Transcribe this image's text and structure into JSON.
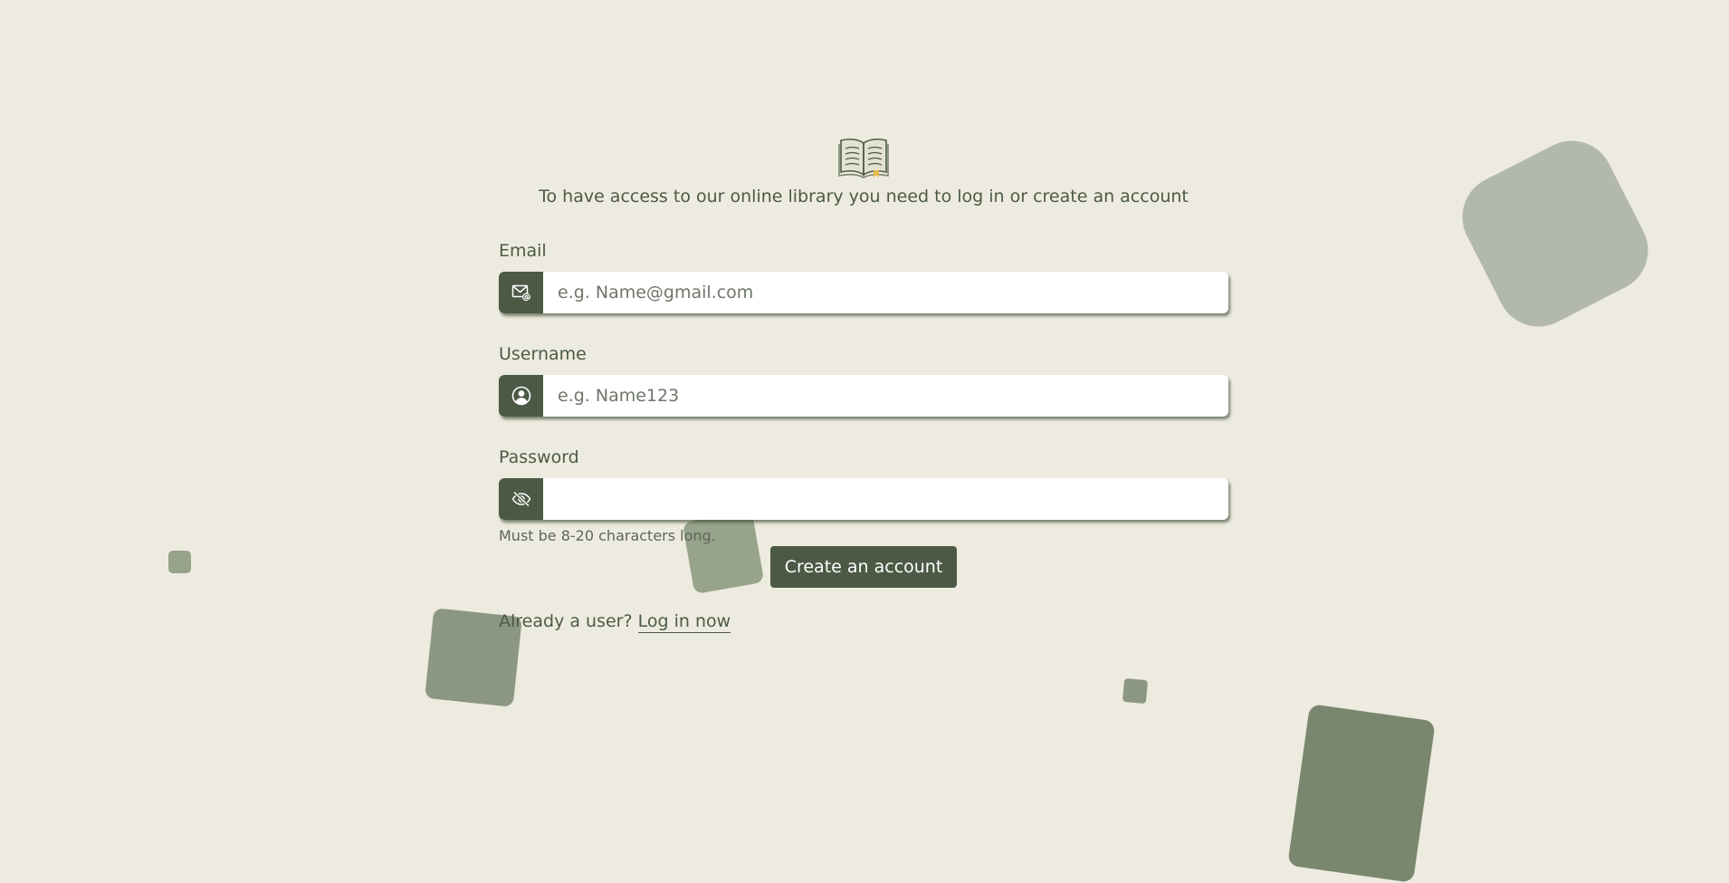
{
  "intro_text": "To have access to our online library you need to log in or create an account",
  "logo": {
    "icon": "open-book-icon"
  },
  "email": {
    "label": "Email",
    "icon": "mail-at-icon",
    "placeholder": "e.g. Name@gmail.com",
    "value": ""
  },
  "username": {
    "label": "Username",
    "icon": "user-circle-icon",
    "placeholder": "e.g. Name123",
    "value": ""
  },
  "password": {
    "label": "Password",
    "icon": "eye-off-icon",
    "placeholder": "",
    "value": "",
    "hint": "Must be 8-20 characters long."
  },
  "create_button_label": "Create an account",
  "login": {
    "prefix": "Already a user?",
    "link_label": "Log in now"
  },
  "colors": {
    "background": "#edebdf",
    "primary": "#4c5a45",
    "decor_light": "#b3b9aa",
    "decor_mid": "#8c9782",
    "decor_dark": "#7a876f"
  }
}
